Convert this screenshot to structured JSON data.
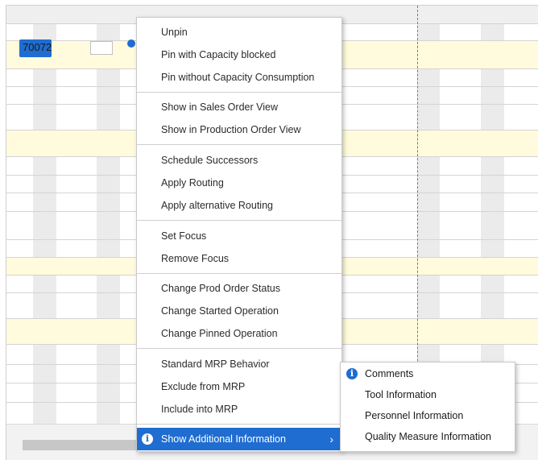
{
  "task": {
    "label": "70072"
  },
  "menu": {
    "groups": [
      [
        "Unpin",
        "Pin with Capacity blocked",
        "Pin without Capacity Consumption"
      ],
      [
        "Show in Sales Order View",
        "Show in Production Order View"
      ],
      [
        "Schedule Successors",
        "Apply Routing",
        "Apply alternative Routing"
      ],
      [
        "Set Focus",
        "Remove Focus"
      ],
      [
        "Change Prod Order Status",
        "Change Started Operation",
        "Change Pinned Operation"
      ],
      [
        "Standard MRP Behavior",
        "Exclude from MRP",
        "Include into MRP"
      ]
    ],
    "active_item": "Show Additional Information",
    "active_item_icon": "info-icon",
    "submenu_arrow": "›"
  },
  "submenu": {
    "items": [
      "Comments",
      "Tool Information",
      "Personnel Information",
      "Quality Measure Information"
    ],
    "first_item_icon": "info-icon"
  },
  "colors": {
    "accent": "#1f6dd0",
    "highlight_row": "#fffbdc"
  }
}
